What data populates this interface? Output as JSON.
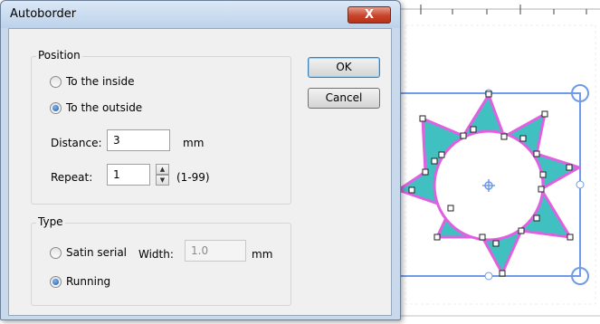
{
  "dialog": {
    "title": "Autoborder",
    "close_glyph": "X"
  },
  "position_group": {
    "label": "Position",
    "inside_label": "To the inside",
    "outside_label": "To the outside",
    "selected": "outside",
    "distance_label": "Distance:",
    "distance_value": "3",
    "distance_unit": "mm",
    "repeat_label": "Repeat:",
    "repeat_value": "1",
    "repeat_range": "(1-99)"
  },
  "type_group": {
    "label": "Type",
    "satin_label": "Satin serial",
    "width_label": "Width:",
    "width_value": "1.0",
    "width_unit": "mm",
    "running_label": "Running",
    "selected": "running"
  },
  "buttons": {
    "ok": "OK",
    "cancel": "Cancel"
  },
  "design": {
    "fill_color": "#40c0c0",
    "outline_color": "#e060e0",
    "selection_color": "#6f9be8",
    "icons": [
      "star-design",
      "selection-handle-icon",
      "center-crosshair-icon"
    ]
  }
}
